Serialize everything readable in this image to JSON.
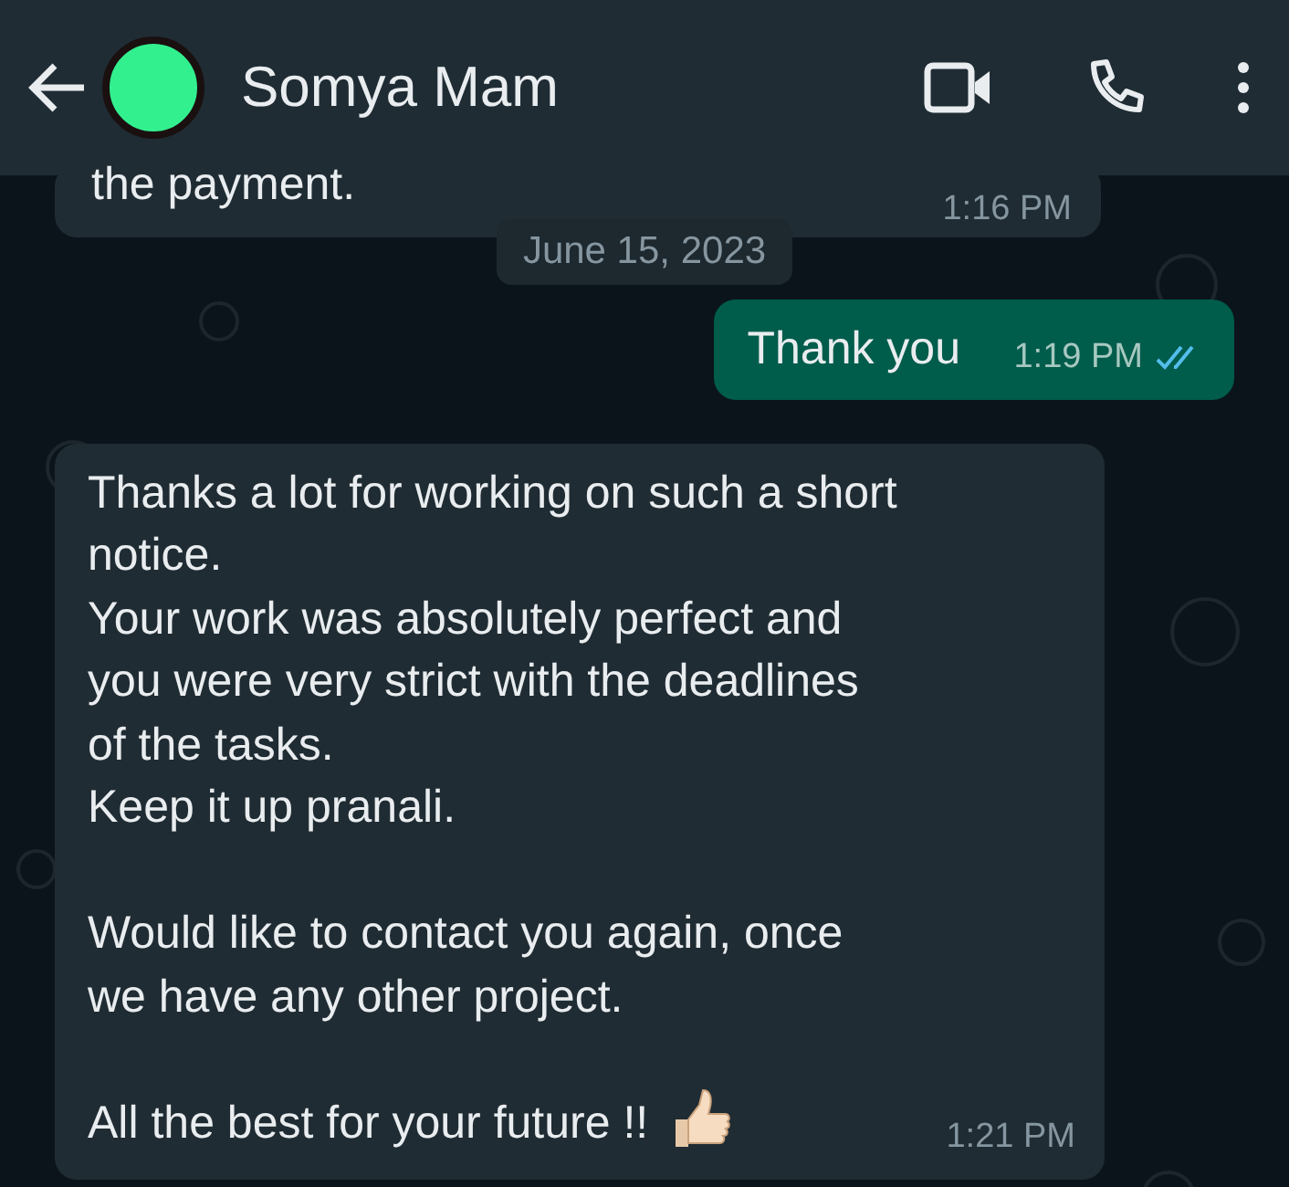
{
  "header": {
    "contact_name": "Somya Mam"
  },
  "messages": [
    {
      "kind": "incoming",
      "text": "the payment.",
      "time": "1:16 PM",
      "emoji": false
    },
    {
      "kind": "date",
      "text": "June 15, 2023"
    },
    {
      "kind": "outgoing",
      "text": "Thank you",
      "time": "1:19 PM",
      "read": true,
      "emoji": false
    },
    {
      "kind": "incoming",
      "text": "Thanks a lot for working on such a short\nnotice.\nYour work was absolutely perfect and\nyou were very strict with the deadlines\nof the tasks.\nKeep it up pranali.\n\nWould like to contact you again, once\nwe have any other project.\n\nAll the best for your future !!",
      "time": "1:21 PM",
      "emoji": true
    }
  ]
}
